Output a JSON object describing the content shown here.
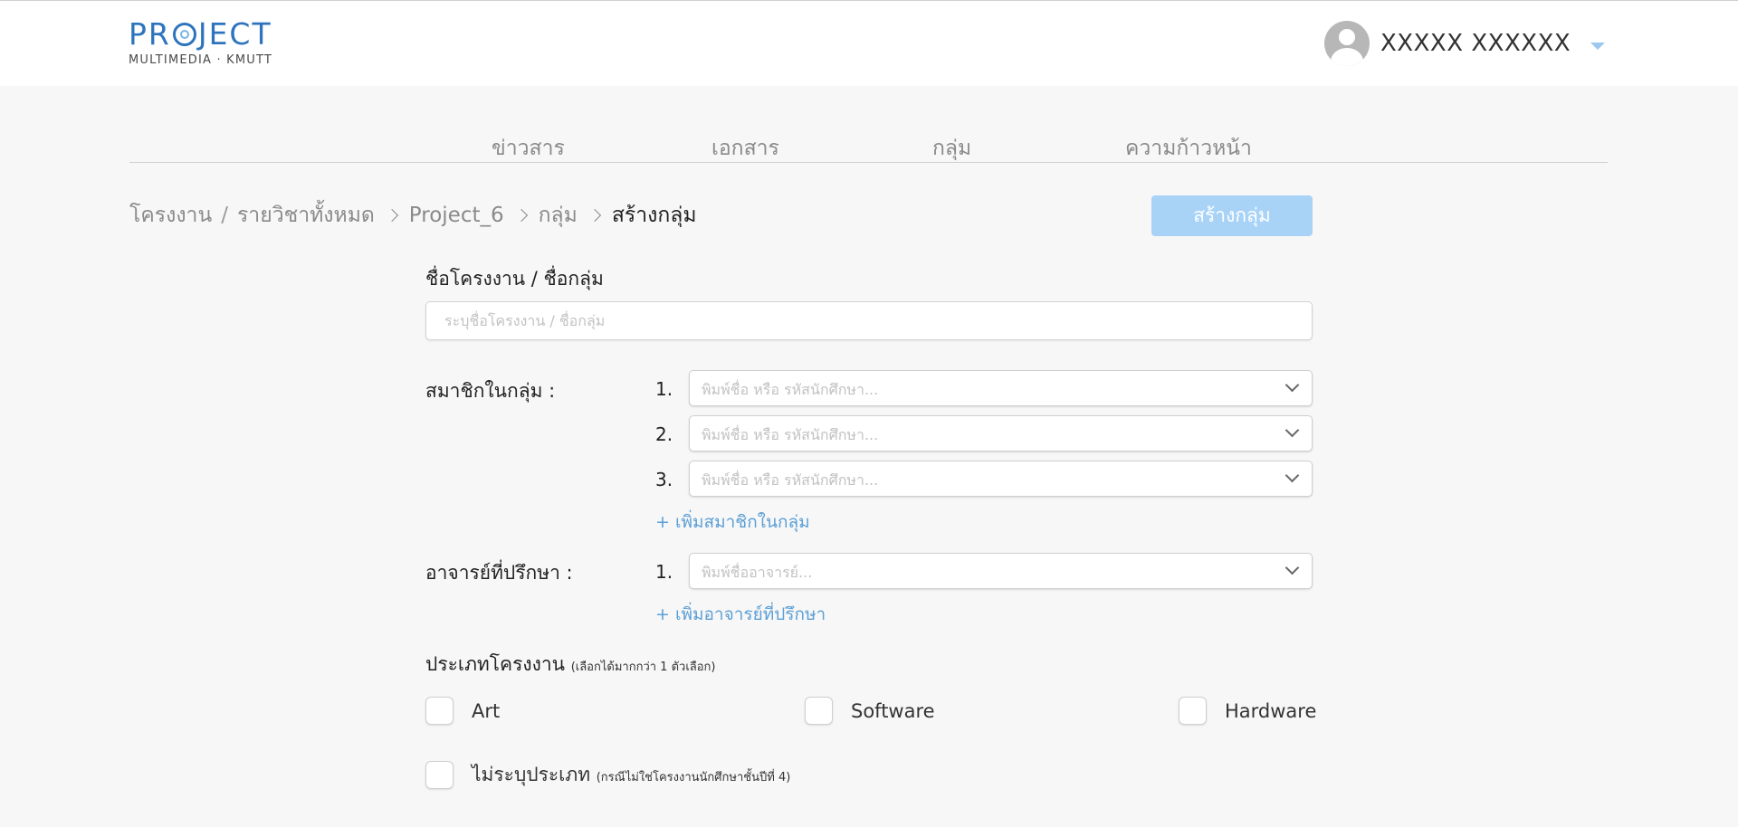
{
  "header": {
    "logo_main": "PROJECT",
    "logo_sub": "MULTIMEDIA · KMUTT",
    "user_name": "XXXXX XXXXXX"
  },
  "nav": {
    "items": [
      "ข่าวสาร",
      "เอกสาร",
      "กลุ่ม",
      "ความก้าวหน้า"
    ]
  },
  "breadcrumb": {
    "root": "โครงงาน",
    "separator": "/",
    "all_courses": "รายวิชาทั้งหมด",
    "project": "Project_6",
    "group": "กลุ่ม",
    "current": "สร้างกลุ่ม"
  },
  "create_button": {
    "label": "สร้างกลุ่ม",
    "color": "#a8d3f7"
  },
  "project_name": {
    "label": "ชื่อโครงงาน / ชื่อกลุ่ม",
    "placeholder": "ระบุชื่อโครงงาน / ชื่อกลุ่ม"
  },
  "members": {
    "label": "สมาชิกในกลุ่ม :",
    "rows": [
      {
        "num": "1.",
        "placeholder": "พิมพ์ชื่อ หรือ รหัสนักศึกษา..."
      },
      {
        "num": "2.",
        "placeholder": "พิมพ์ชื่อ หรือ รหัสนักศึกษา..."
      },
      {
        "num": "3.",
        "placeholder": "พิมพ์ชื่อ หรือ รหัสนักศึกษา..."
      }
    ],
    "add_label": "+ เพิ่มสมาชิกในกลุ่ม"
  },
  "advisors": {
    "label": "อาจารย์ที่ปรึกษา :",
    "rows": [
      {
        "num": "1.",
        "placeholder": "พิมพ์ชื่ออาจารย์..."
      }
    ],
    "add_label": "+ เพิ่มอาจารย์ที่ปรึกษา"
  },
  "project_type": {
    "label": "ประเภทโครงงาน",
    "note": "(เลือกได้มากกว่า 1 ตัวเลือก)",
    "options": [
      "Art",
      "Software",
      "Hardware"
    ],
    "none_label": "ไม่ระบุประเภท",
    "none_note": "(กรณีไม่ใช่โครงงานนักศึกษาชั้นปีที่ 4)"
  },
  "colors": {
    "brand_blue": "#2d74bd",
    "link_blue": "#5b9fd6",
    "background": "#f7f7f7"
  }
}
